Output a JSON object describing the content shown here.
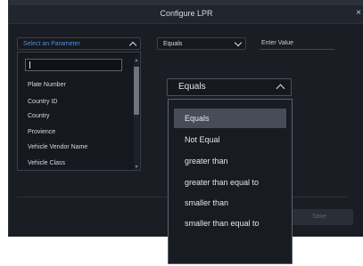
{
  "dialog": {
    "title": "Configure LPR",
    "close_glyph": "×",
    "save_label": "Save"
  },
  "filter": {
    "parameter_placeholder": "Select an Parameter",
    "operator_value": "Equals",
    "value_placeholder": "Enter Value"
  },
  "parameter_list": {
    "items": [
      "Plate Number",
      "Country ID",
      "Country",
      "Provience",
      "Vehicle Vendor Name",
      "Vehicle Class"
    ]
  },
  "operator_dropdown": {
    "selected": "Equals",
    "options": [
      "Equals",
      "Not Equal",
      "greater than",
      "greater than equal to",
      "smaller than",
      "smaller than equal to"
    ]
  },
  "colors": {
    "accent_blue": "#4a8fe2",
    "background": "#1a1e24",
    "error_underline": "#8a2a2a"
  },
  "icons": {
    "chevron_up": "chevron-up-icon",
    "chevron_down": "chevron-down-icon",
    "close": "close-icon"
  }
}
